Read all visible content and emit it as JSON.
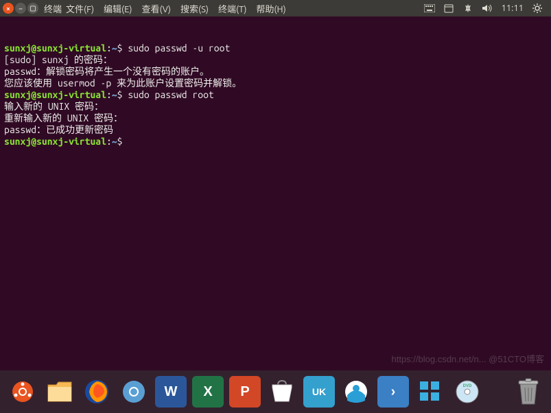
{
  "menubar": {
    "app_title": "终端",
    "items": [
      "文件(F)",
      "编辑(E)",
      "查看(V)",
      "搜索(S)",
      "终端(T)",
      "帮助(H)"
    ],
    "clock": "11:11"
  },
  "terminal": {
    "lines": [
      {
        "type": "prompt",
        "user": "sunxj@sunxj-virtual",
        "path": "~",
        "cmd": "sudo passwd -u root"
      },
      {
        "type": "text",
        "text": "[sudo] sunxj 的密码："
      },
      {
        "type": "text",
        "text": "passwd：解锁密码将产生一个没有密码的账户。"
      },
      {
        "type": "text",
        "text": "您应该使用 usermod -p 来为此账户设置密码并解锁。"
      },
      {
        "type": "prompt",
        "user": "sunxj@sunxj-virtual",
        "path": "~",
        "cmd": "sudo passwd root"
      },
      {
        "type": "text",
        "text": "输入新的 UNIX 密码："
      },
      {
        "type": "text",
        "text": "重新输入新的 UNIX 密码："
      },
      {
        "type": "text",
        "text": "passwd：已成功更新密码"
      },
      {
        "type": "prompt",
        "user": "sunxj@sunxj-virtual",
        "path": "~",
        "cmd": ""
      }
    ],
    "watermark": "https://blog.csdn.net/n... @51CTO博客"
  },
  "dock": {
    "items": [
      {
        "name": "show-apps",
        "bg": "#a24b8c",
        "label": ""
      },
      {
        "name": "files",
        "bg": "#f7c16b",
        "label": ""
      },
      {
        "name": "firefox",
        "bg": "#1a4aa0",
        "label": ""
      },
      {
        "name": "chromium",
        "bg": "#e8e8e8",
        "label": ""
      },
      {
        "name": "word",
        "bg": "#2b579a",
        "label": "W"
      },
      {
        "name": "excel",
        "bg": "#217346",
        "label": "X"
      },
      {
        "name": "powerpoint",
        "bg": "#d24726",
        "label": "P"
      },
      {
        "name": "software",
        "bg": "#ffffff",
        "label": ""
      },
      {
        "name": "input-uk",
        "bg": "#34a0ce",
        "label": "UK"
      },
      {
        "name": "app-blue",
        "bg": "#2a9fd6",
        "label": ""
      },
      {
        "name": "app-arrow",
        "bg": "#3b7fc4",
        "label": "›"
      },
      {
        "name": "app-grid",
        "bg": "#2a9fd6",
        "label": ""
      },
      {
        "name": "disc",
        "bg": "#5aa7d8",
        "label": ""
      }
    ]
  }
}
